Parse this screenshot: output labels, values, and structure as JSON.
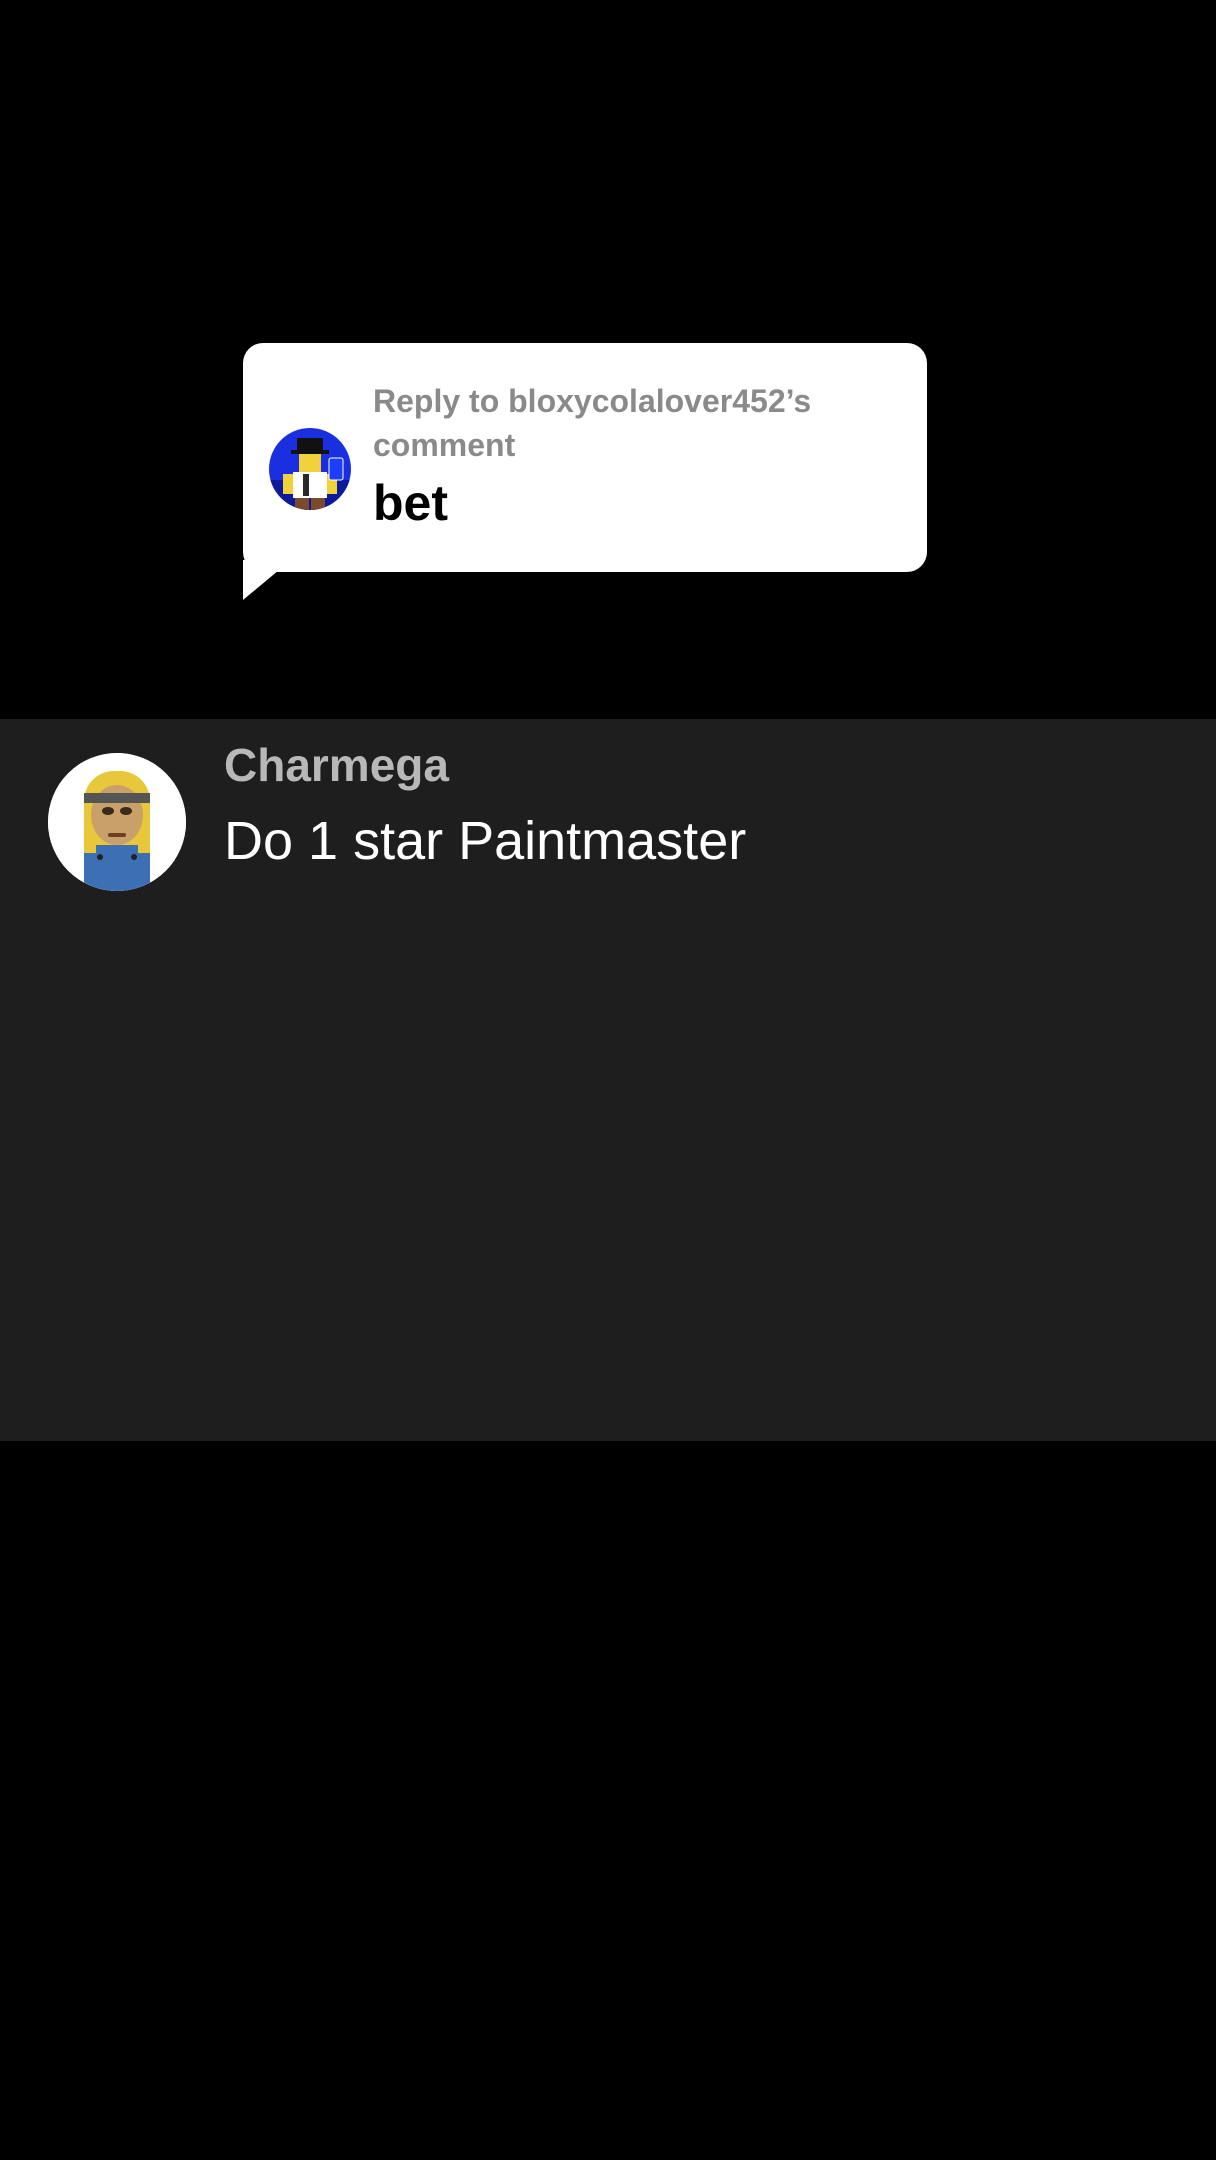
{
  "reply_sticker": {
    "heading_line1": "Reply to bloxycolalover452’s",
    "heading_line2": "comment",
    "text": "bet",
    "avatar_icon": "roblox-avatar-blue-icon"
  },
  "comment": {
    "username": "Charmega",
    "text": "Do 1 star Paintmaster",
    "avatar_icon": "minion-avatar-icon"
  },
  "colors": {
    "background": "#000000",
    "panel": "#1e1e1e",
    "bubble": "#ffffff",
    "heading_gray": "#8a8a8a",
    "username_gray": "#b8b8b8"
  }
}
